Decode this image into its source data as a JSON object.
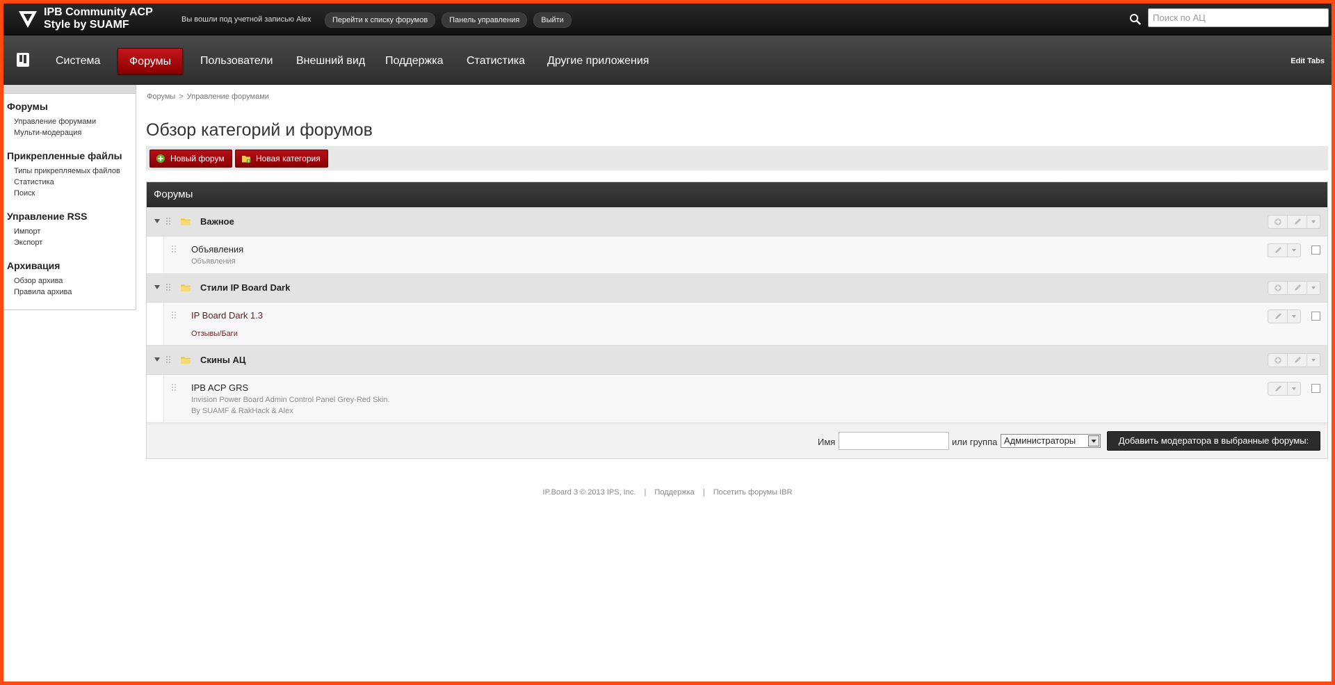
{
  "header": {
    "logo_line1": "IPB Community ACP",
    "logo_line2": "Style by SUAMF",
    "logged_in_text": "Вы вошли под учетной записью Alex",
    "links": [
      "Перейти к списку форумов",
      "Панель управления",
      "Выйти"
    ],
    "search_placeholder": "Поиск по АЦ"
  },
  "nav": {
    "tabs": [
      "Система",
      "Форумы",
      "Пользователи",
      "Внешний вид",
      "Поддержка",
      "Статистика",
      "Другие приложения"
    ],
    "active_tab": "Форумы",
    "edit_tabs": "Edit Tabs"
  },
  "sidebar": {
    "groups": [
      {
        "title": "Форумы",
        "items": [
          "Управление форумами",
          "Мульти-модерация"
        ]
      },
      {
        "title": "Прикрепленные файлы",
        "items": [
          "Типы прикрепляемых файлов",
          "Статистика",
          "Поиск"
        ]
      },
      {
        "title": "Управление RSS",
        "items": [
          "Импорт",
          "Экспорт"
        ]
      },
      {
        "title": "Архивация",
        "items": [
          "Обзор архива",
          "Правила архива"
        ]
      }
    ]
  },
  "breadcrumb": [
    "Форумы",
    "Управление форумами"
  ],
  "breadcrumb_sep": ">",
  "page_title": "Обзор категорий и форумов",
  "actions": {
    "new_forum": "Новый форум",
    "new_category": "Новая категория"
  },
  "panel": {
    "title": "Форумы",
    "categories": [
      {
        "name": "Важное",
        "forums": [
          {
            "name": "Объявления",
            "desc": "Объявления"
          }
        ]
      },
      {
        "name": "Стили IP Board Dark",
        "forums": [
          {
            "name": "IP Board Dark 1.3",
            "desc": "Отзывы/Баги"
          }
        ]
      },
      {
        "name": "Скины АЦ",
        "forums": [
          {
            "name": "IPB ACP GRS",
            "desc_lines": [
              "Invision Power Board Admin Control Panel Grey-Red Skin.",
              "By SUAMF & RakHack & Alex"
            ]
          }
        ]
      }
    ]
  },
  "moderator": {
    "name_label": "Имя",
    "name_value": "",
    "group_label": "или группа",
    "group_selected": "Администраторы",
    "submit": "Добавить модератора в выбранные форумы:"
  },
  "footer": {
    "copyright": "IP.Board 3 © 2013 IPS, Inc.",
    "support": "Поддержка",
    "visit": "Посетить форумы IBR",
    "sep": "|"
  },
  "colors": {
    "accent": "#ff4a12",
    "brand_red": "#b51116",
    "dark": "#2c2c2c"
  }
}
